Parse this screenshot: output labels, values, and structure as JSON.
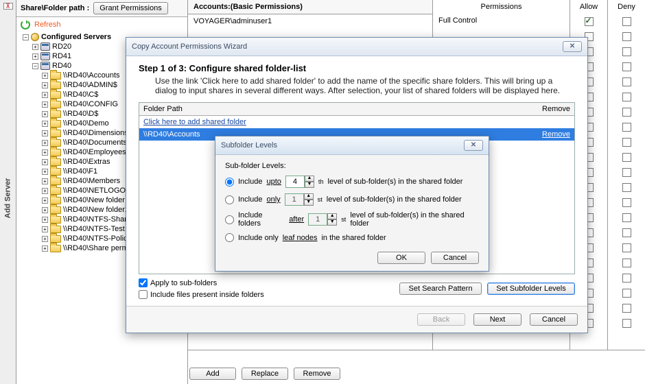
{
  "vtab": {
    "label": "Add Server"
  },
  "tree_header": {
    "label": "Share\\Folder path :",
    "grant_btn": "Grant Permissions"
  },
  "refresh": {
    "label": "Refresh"
  },
  "tree": {
    "root": "Configured Servers",
    "servers": [
      {
        "name": "RD20",
        "expanded": false
      },
      {
        "name": "RD41",
        "expanded": false
      },
      {
        "name": "RD40",
        "expanded": true,
        "shares": [
          "\\\\RD40\\Accounts",
          "\\\\RD40\\ADMIN$",
          "\\\\RD40\\C$",
          "\\\\RD40\\CONFIG",
          "\\\\RD40\\D$",
          "\\\\RD40\\Demo",
          "\\\\RD40\\Dimensions",
          "\\\\RD40\\Documents",
          "\\\\RD40\\Employees",
          "\\\\RD40\\Extras",
          "\\\\RD40\\F1",
          "\\\\RD40\\Members",
          "\\\\RD40\\NETLOGON",
          "\\\\RD40\\New folder",
          "\\\\RD40\\New folder2",
          "\\\\RD40\\NTFS-Share",
          "\\\\RD40\\NTFS-Test",
          "\\\\RD40\\NTFS-Policy",
          "\\\\RD40\\Share permissions"
        ]
      }
    ]
  },
  "accounts": {
    "title": "Accounts:(Basic Permissions)",
    "rows": [
      "VOYAGER\\adminuser1"
    ]
  },
  "perm_headers": {
    "perm": "Permissions",
    "allow": "Allow",
    "deny": "Deny"
  },
  "perm_rows": [
    {
      "name": "Full Control",
      "allow": true,
      "deny": false
    }
  ],
  "perm_extra_rows": 20,
  "bottom_buttons": {
    "add": "Add",
    "replace": "Replace",
    "remove": "Remove"
  },
  "wizard": {
    "title": "Copy Account Permissions Wizard",
    "step": "Step 1 of 3: Configure shared folder-list",
    "desc": "Use the link 'Click here to add shared folder' to add the name of the specific share folders. This will bring up a dialog to input shares in several different ways. After selection, your list of shared folders will be displayed here.",
    "folder_table": {
      "col_folder": "Folder Path",
      "col_remove": "Remove",
      "add_link": "Click here to add shared folder",
      "rows": [
        {
          "path": "\\\\RD40\\Accounts",
          "remove": "Remove",
          "selected": true
        }
      ]
    },
    "apply_sub": "Apply to sub-folders",
    "apply_sub_checked": true,
    "include_files": "Include files present inside folders",
    "include_files_checked": false,
    "btn_pattern": "Set Search Pattern",
    "btn_levels": "Set Subfolder Levels",
    "btn_back": "Back",
    "btn_next": "Next",
    "btn_cancel": "Cancel"
  },
  "subdlg": {
    "title": "Subfolder Levels",
    "label": "Sub-folder Levels:",
    "opt1a": "Include ",
    "opt1b": "upto",
    "opt1_val": "4",
    "opt1_suffix": "th",
    "opt1c": " level of sub-folder(s) in the shared folder",
    "opt2a": "Include ",
    "opt2b": "only",
    "opt2_val": "1",
    "opt2_suffix": "st",
    "opt2c": " level of sub-folder(s) in the shared folder",
    "opt3a": "Include folders ",
    "opt3b": "after",
    "opt3_val": "1",
    "opt3_suffix": "st",
    "opt3c": "  level of sub-folder(s) in the shared folder",
    "opt4a": "Include only ",
    "opt4b": "leaf nodes",
    "opt4c": " in the shared folder",
    "selected": 1,
    "ok": "OK",
    "cancel": "Cancel"
  }
}
